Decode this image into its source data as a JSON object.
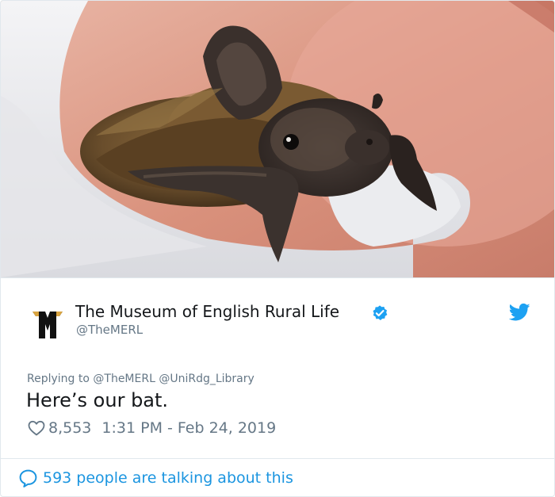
{
  "photo": {
    "subject": "bat-photo"
  },
  "author": {
    "name": "The Museum of English Rural Life",
    "handle": "@TheMERL",
    "logo_letter": "M",
    "verified": true
  },
  "tweet": {
    "replying_prefix": "Replying to ",
    "mention_1": "@TheMERL",
    "mention_2": "@UniRdg_Library",
    "text": "Here’s our bat.",
    "likes": "8,553",
    "timestamp": "1:31 PM - Feb 24, 2019"
  },
  "footer": {
    "talking": "593 people are talking about this"
  },
  "colors": {
    "twitter_blue": "#1da1f2",
    "link_blue": "#1b95e0",
    "muted_gray": "#657786",
    "text_dark": "#14171a",
    "logo_gold": "#d9a441"
  },
  "icons": [
    "verified-badge-icon",
    "twitter-bird-icon",
    "heart-icon",
    "speech-bubble-icon"
  ]
}
